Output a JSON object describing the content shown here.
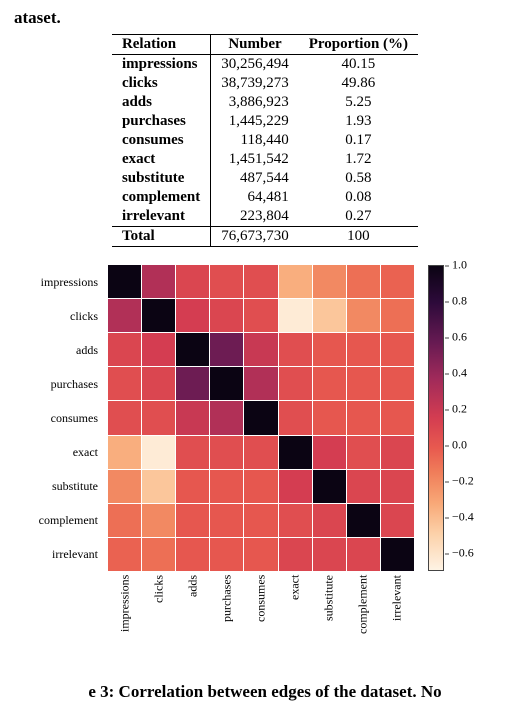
{
  "fragment_top": "ataset.",
  "table": {
    "headers": {
      "relation": "Relation",
      "number": "Number",
      "proportion": "Proportion (%)"
    },
    "rows": [
      {
        "relation": "impressions",
        "number": "30,256,494",
        "proportion": "40.15"
      },
      {
        "relation": "clicks",
        "number": "38,739,273",
        "proportion": "49.86"
      },
      {
        "relation": "adds",
        "number": "3,886,923",
        "proportion": "5.25"
      },
      {
        "relation": "purchases",
        "number": "1,445,229",
        "proportion": "1.93"
      },
      {
        "relation": "consumes",
        "number": "118,440",
        "proportion": "0.17"
      },
      {
        "relation": "exact",
        "number": "1,451,542",
        "proportion": "1.72"
      },
      {
        "relation": "substitute",
        "number": "487,544",
        "proportion": "0.58"
      },
      {
        "relation": "complement",
        "number": "64,481",
        "proportion": "0.08"
      },
      {
        "relation": "irrelevant",
        "number": "223,804",
        "proportion": "0.27"
      }
    ],
    "total": {
      "label": "Total",
      "number": "76,673,730",
      "proportion": "100"
    }
  },
  "chart_data": {
    "type": "heatmap",
    "title": "",
    "xlabel": "",
    "ylabel": "",
    "categories": [
      "impressions",
      "clicks",
      "adds",
      "purchases",
      "consumes",
      "exact",
      "substitute",
      "complement",
      "irrelevant"
    ],
    "colorbar_ticks": [
      "1.0",
      "0.8",
      "0.6",
      "0.4",
      "0.2",
      "0.0",
      "−0.2",
      "−0.4",
      "−0.6"
    ],
    "vmin": -0.7,
    "vmax": 1.0,
    "matrix": [
      [
        1.0,
        0.3,
        0.1,
        0.05,
        0.05,
        -0.35,
        -0.2,
        -0.1,
        -0.05
      ],
      [
        0.3,
        1.0,
        0.15,
        0.1,
        0.05,
        -0.65,
        -0.45,
        -0.2,
        -0.1
      ],
      [
        0.1,
        0.15,
        1.0,
        0.55,
        0.2,
        0.05,
        0.0,
        0.0,
        0.0
      ],
      [
        0.05,
        0.1,
        0.55,
        1.0,
        0.3,
        0.05,
        0.0,
        0.0,
        0.0
      ],
      [
        0.05,
        0.05,
        0.2,
        0.3,
        1.0,
        0.05,
        0.0,
        0.0,
        0.0
      ],
      [
        -0.35,
        -0.65,
        0.05,
        0.05,
        0.05,
        1.0,
        0.15,
        0.05,
        0.1
      ],
      [
        -0.2,
        -0.45,
        0.0,
        0.0,
        0.0,
        0.15,
        1.0,
        0.1,
        0.1
      ],
      [
        -0.1,
        -0.2,
        0.0,
        0.0,
        0.0,
        0.05,
        0.1,
        1.0,
        0.1
      ],
      [
        -0.05,
        -0.1,
        0.0,
        0.0,
        0.0,
        0.1,
        0.1,
        0.1,
        1.0
      ]
    ]
  },
  "fragment_bottom": "e 3: Correlation between edges of the dataset. No"
}
